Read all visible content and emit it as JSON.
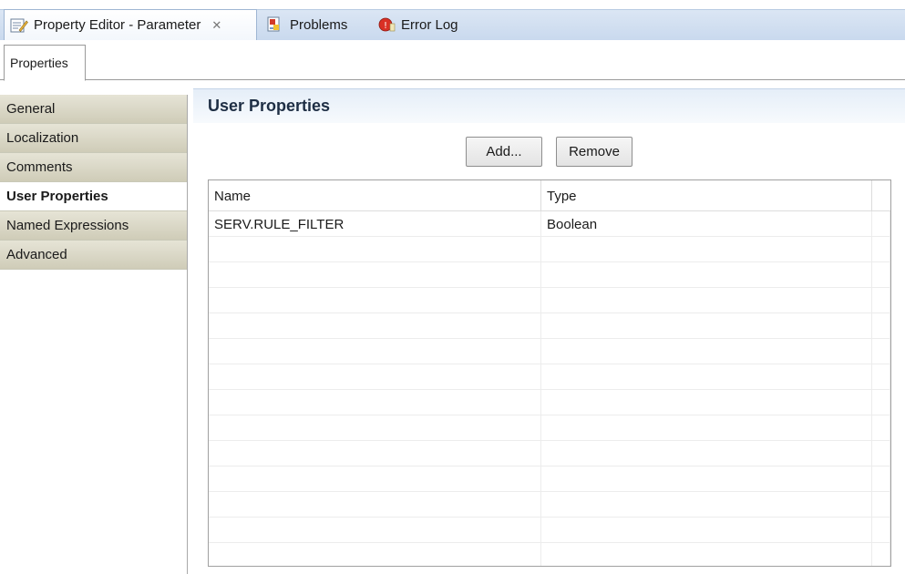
{
  "view_tabs": [
    {
      "label": "Property Editor - Parameter",
      "icon": "edit-doc-icon",
      "active": true,
      "closable": true
    },
    {
      "label": "Problems",
      "icon": "problems-icon",
      "active": false
    },
    {
      "label": "Error Log",
      "icon": "error-log-icon",
      "active": false
    }
  ],
  "subtab": {
    "label": "Properties"
  },
  "categories": [
    {
      "label": "General",
      "selected": false
    },
    {
      "label": "Localization",
      "selected": false
    },
    {
      "label": "Comments",
      "selected": false
    },
    {
      "label": "User Properties",
      "selected": true
    },
    {
      "label": "Named Expressions",
      "selected": false
    },
    {
      "label": "Advanced",
      "selected": false
    }
  ],
  "section": {
    "title": "User Properties"
  },
  "buttons": {
    "add": "Add...",
    "remove": "Remove"
  },
  "table": {
    "columns": [
      "Name",
      "Type"
    ],
    "rows": [
      {
        "name": "SERV.RULE_FILTER",
        "type": "Boolean"
      }
    ]
  },
  "colors": {
    "view_strip": "#c9d9ee",
    "category_bg": "#cfccb8",
    "section_header": "#e5eef8"
  }
}
